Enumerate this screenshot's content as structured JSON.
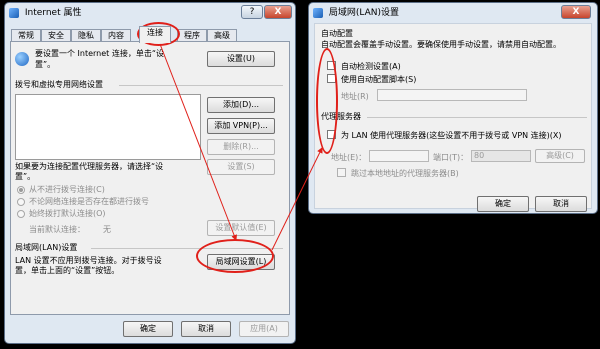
{
  "left_window": {
    "title": "Internet 属性",
    "help_btn": "?",
    "close_btn": "X",
    "tabs": [
      "常规",
      "安全",
      "隐私",
      "内容",
      "连接",
      "程序",
      "高级"
    ],
    "setup_text_line1": "要设置一个 Internet 连接，单击“设",
    "setup_text_line2": "置”。",
    "setup_btn": "设置(U)",
    "dialup_header": "拨号和虚拟专用网络设置",
    "add_btn": "添加(D)...",
    "add_vpn_btn": "添加 VPN(P)...",
    "remove_btn": "删除(R)...",
    "proxy_text_line1": "如果要为连接配置代理服务器，请选择“设",
    "proxy_text_line2": "置”。",
    "settings_btn": "设置(S)",
    "radio_never": "从不进行拨号连接(C)",
    "radio_no_network": "不论网络连接是否存在都进行拨号",
    "radio_always": "始终拨打默认连接(O)",
    "current_default_label": "当前默认连接：",
    "current_default_value": "无",
    "set_default_btn": "设置默认值(E)",
    "lan_header": "局域网(LAN)设置",
    "lan_text_line1": "LAN 设置不应用到拨号连接。对于拨号设",
    "lan_text_line2": "置，单击上面的“设置”按钮。",
    "lan_btn": "局域网设置(L)",
    "ok_btn": "确定",
    "cancel_btn": "取消",
    "apply_btn": "应用(A)"
  },
  "right_window": {
    "title": "局域网(LAN)设置",
    "close_btn": "X",
    "auto_config_header": "自动配置",
    "auto_config_desc": "自动配置会覆盖手动设置。要确保使用手动设置，请禁用自动配置。",
    "auto_detect_label": "自动检测设置(A)",
    "auto_script_label": "使用自动配置脚本(S)",
    "address_label": "地址(R)",
    "proxy_header": "代理服务器",
    "proxy_use_label": "为 LAN 使用代理服务器(这些设置不用于拨号或 VPN 连接)(X)",
    "proxy_address_label": "地址(E)：",
    "proxy_port_label": "端口(T)：",
    "proxy_port_value": "80",
    "advanced_btn": "高级(C)",
    "bypass_label": "跳过本地地址的代理服务器(B)",
    "ok_btn": "确定",
    "cancel_btn": "取消"
  },
  "colors": {
    "annotation": "#e0201a",
    "titlebar": "#dfe8f2"
  }
}
